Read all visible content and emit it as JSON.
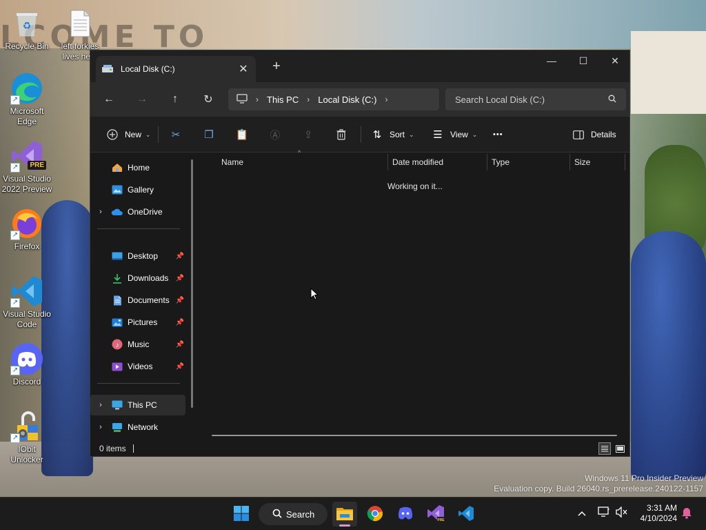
{
  "desktop": {
    "wallpaper_text": "LCOME TO",
    "icons": [
      {
        "label": "Recycle Bin"
      },
      {
        "label": "left forkies lives here"
      },
      {
        "label": "Microsoft Edge"
      },
      {
        "label": "Visual Studio 2022 Preview",
        "badge": "PRE"
      },
      {
        "label": "Firefox"
      },
      {
        "label": "Visual Studio Code"
      },
      {
        "label": "Discord"
      },
      {
        "label": "IObit Unlocker"
      }
    ]
  },
  "window": {
    "tab_title": "Local Disk (C:)",
    "tab_close": "✕",
    "new_tab": "+",
    "controls": {
      "minimize": "—",
      "maximize": "☐",
      "close": "✕"
    },
    "breadcrumb": [
      "This PC",
      "Local Disk (C:)"
    ],
    "search_placeholder": "Search Local Disk (C:)",
    "toolbar": {
      "new_label": "New",
      "sort_label": "Sort",
      "view_label": "View",
      "more_label": "•••",
      "details_label": "Details"
    },
    "sidebar": {
      "quick": [
        {
          "label": "Home"
        },
        {
          "label": "Gallery"
        },
        {
          "label": "OneDrive"
        }
      ],
      "pinned": [
        {
          "label": "Desktop"
        },
        {
          "label": "Downloads"
        },
        {
          "label": "Documents"
        },
        {
          "label": "Pictures"
        },
        {
          "label": "Music"
        },
        {
          "label": "Videos"
        }
      ],
      "locations": [
        {
          "label": "This PC"
        },
        {
          "label": "Network"
        }
      ]
    },
    "columns": [
      "Name",
      "Date modified",
      "Type",
      "Size"
    ],
    "loading_text": "Working on it...",
    "status_text": "0 items"
  },
  "watermark": {
    "line1": "Windows 11 Pro Insider Preview",
    "line2": "Evaluation copy. Build 26040.rs_prerelease.240122-1157"
  },
  "taskbar": {
    "search_label": "Search",
    "time": "3:31 AM",
    "date": "4/10/2024"
  },
  "colors": {
    "window_bg": "#191919",
    "accent_blue": "#0078d4",
    "folder_yellow": "#f4c430"
  }
}
